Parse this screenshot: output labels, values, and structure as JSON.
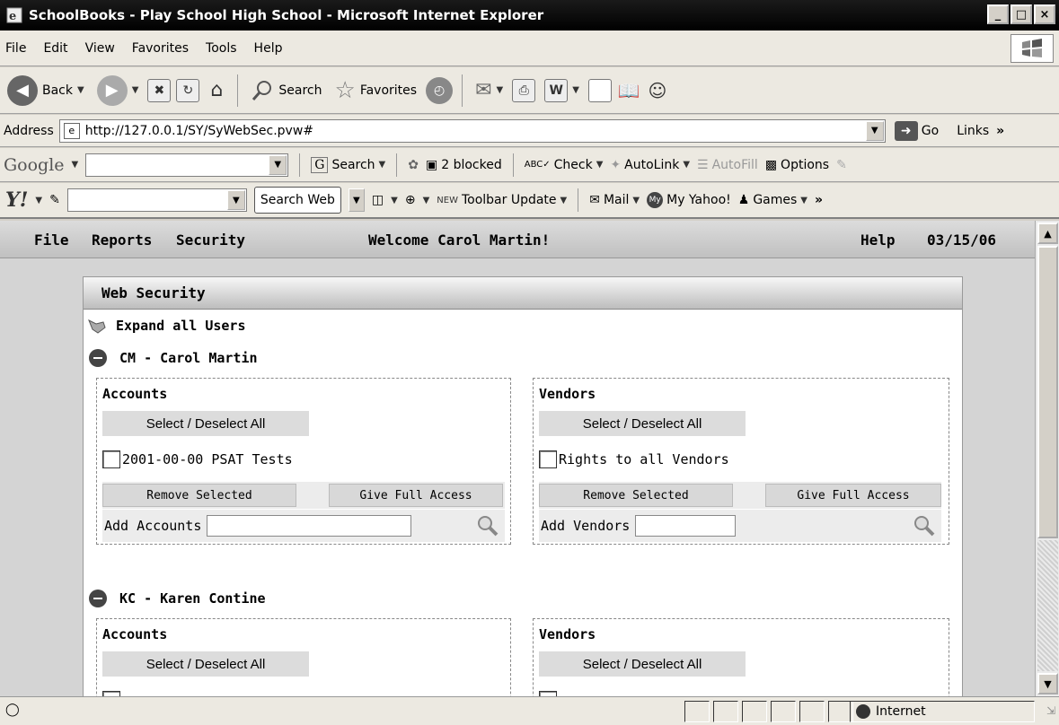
{
  "window": {
    "title": "SchoolBooks - Play School High School - Microsoft Internet Explorer",
    "controls": [
      "_",
      "□",
      "×"
    ]
  },
  "menubar": {
    "items": [
      {
        "label": "File"
      },
      {
        "label": "Edit"
      },
      {
        "label": "View"
      },
      {
        "label": "Favorites"
      },
      {
        "label": "Tools"
      },
      {
        "label": "Help"
      }
    ]
  },
  "toolbar": {
    "back": "Back",
    "search": "Search",
    "favorites": "Favorites"
  },
  "address": {
    "label": "Address",
    "url": "http://127.0.0.1/SY/SyWebSec.pvw#",
    "go": "Go",
    "links": "Links",
    "more": "»"
  },
  "google": {
    "logo": "Google",
    "search": "Search",
    "blocked": "2 blocked",
    "check": "Check",
    "autolink": "AutoLink",
    "autofill": "AutoFill",
    "options": "Options"
  },
  "yahoo": {
    "logo": "Y!",
    "search_web": "Search Web",
    "new_tag": "NEW",
    "toolbar_update": "Toolbar Update",
    "mail": "Mail",
    "my_yahoo": "My Yahoo!",
    "games": "Games",
    "more": "»"
  },
  "app": {
    "nav": {
      "file": "File",
      "reports": "Reports",
      "security": "Security",
      "welcome": "Welcome Carol Martin!",
      "help": "Help",
      "date": "03/15/06"
    },
    "panel": {
      "title": "Web Security",
      "expand_all": "Expand all Users",
      "users": [
        {
          "label": "CM - Carol Martin",
          "accounts": {
            "title": "Accounts",
            "select_all": "Select / Deselect All",
            "item": "2001-00-00 PSAT Tests",
            "remove": "Remove Selected",
            "full": "Give Full Access",
            "add_label": "Add Accounts"
          },
          "vendors": {
            "title": "Vendors",
            "select_all": "Select / Deselect All",
            "item": "Rights to all Vendors",
            "remove": "Remove Selected",
            "full": "Give Full Access",
            "add_label": "Add Vendors"
          }
        },
        {
          "label": "KC - Karen Contine",
          "accounts": {
            "title": "Accounts",
            "select_all": "Select / Deselect All"
          },
          "vendors": {
            "title": "Vendors",
            "select_all": "Select / Deselect All"
          }
        }
      ]
    }
  },
  "status": {
    "zone": "Internet"
  }
}
